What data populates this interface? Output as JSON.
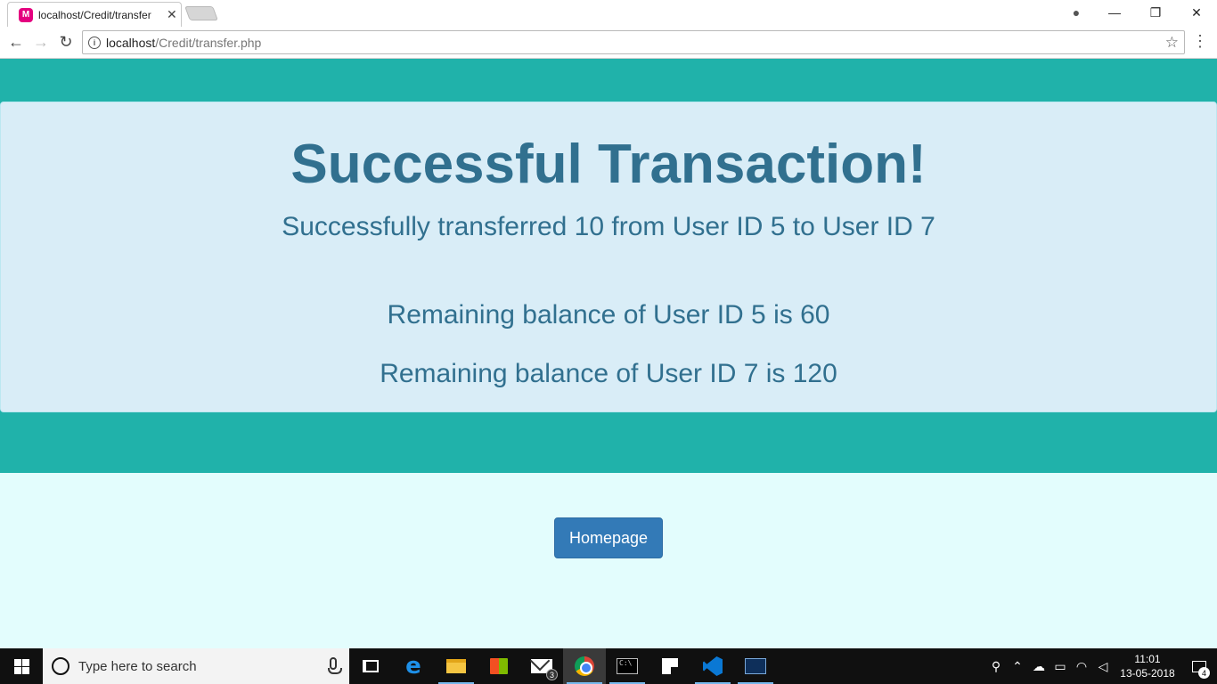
{
  "browser": {
    "tab": {
      "title": "localhost/Credit/transfer",
      "favicon_letter": "M",
      "favicon_color": "#e4007f"
    },
    "window_controls": {
      "minimize": "—",
      "maximize": "❐",
      "close": "✕"
    },
    "address": {
      "host": "localhost",
      "path": "/Credit/transfer.php"
    }
  },
  "page": {
    "colors": {
      "band": "#20b2aa",
      "panel": "#d9edf7",
      "panel_text": "#31708f",
      "background": "#e3fdfd",
      "button": "#337ab7"
    },
    "heading": "Successful Transaction!",
    "transfer_message": "Successfully transferred 10 from User ID 5 to User ID 7",
    "balance_line_1": "Remaining balance of User ID 5 is 60",
    "balance_line_2": "Remaining balance of User ID 7 is 120",
    "homepage_button": "Homepage"
  },
  "taskbar": {
    "search_placeholder": "Type here to search",
    "mail_badge": "3",
    "apps": [
      "task-view",
      "edge",
      "file-explorer",
      "store",
      "mail",
      "chrome",
      "cmd",
      "sticky-notes",
      "vscode",
      "mysql-workbench"
    ],
    "clock": {
      "time": "11:01",
      "date": "13-05-2018"
    },
    "notification_count": "4"
  }
}
